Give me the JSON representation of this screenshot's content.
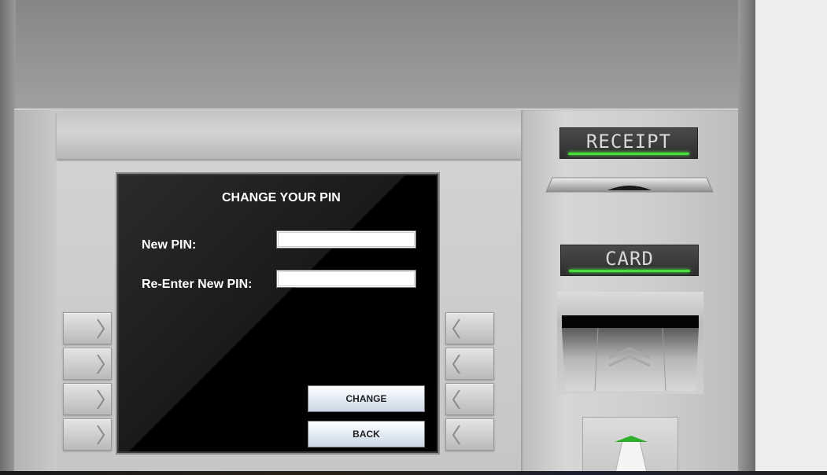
{
  "screen": {
    "title": "CHANGE YOUR PIN",
    "new_pin_label": "New PIN:",
    "reenter_pin_label": "Re-Enter New PIN:",
    "new_pin_value": "",
    "reenter_pin_value": "",
    "change_button": "CHANGE",
    "back_button": "BACK"
  },
  "panel": {
    "receipt_label": "RECEIPT",
    "card_label": "CARD"
  },
  "colors": {
    "indicator_glow": "#46e03c",
    "screen_background": "#000000",
    "button_gradient_bottom": "#c9d6e3"
  },
  "icons": {
    "left_keys": "chevron-right-icon",
    "right_keys": "chevron-left-icon",
    "card_reader": "double-chevron-up-icon",
    "cash_slot": "green-triangle-indicator-icon"
  }
}
